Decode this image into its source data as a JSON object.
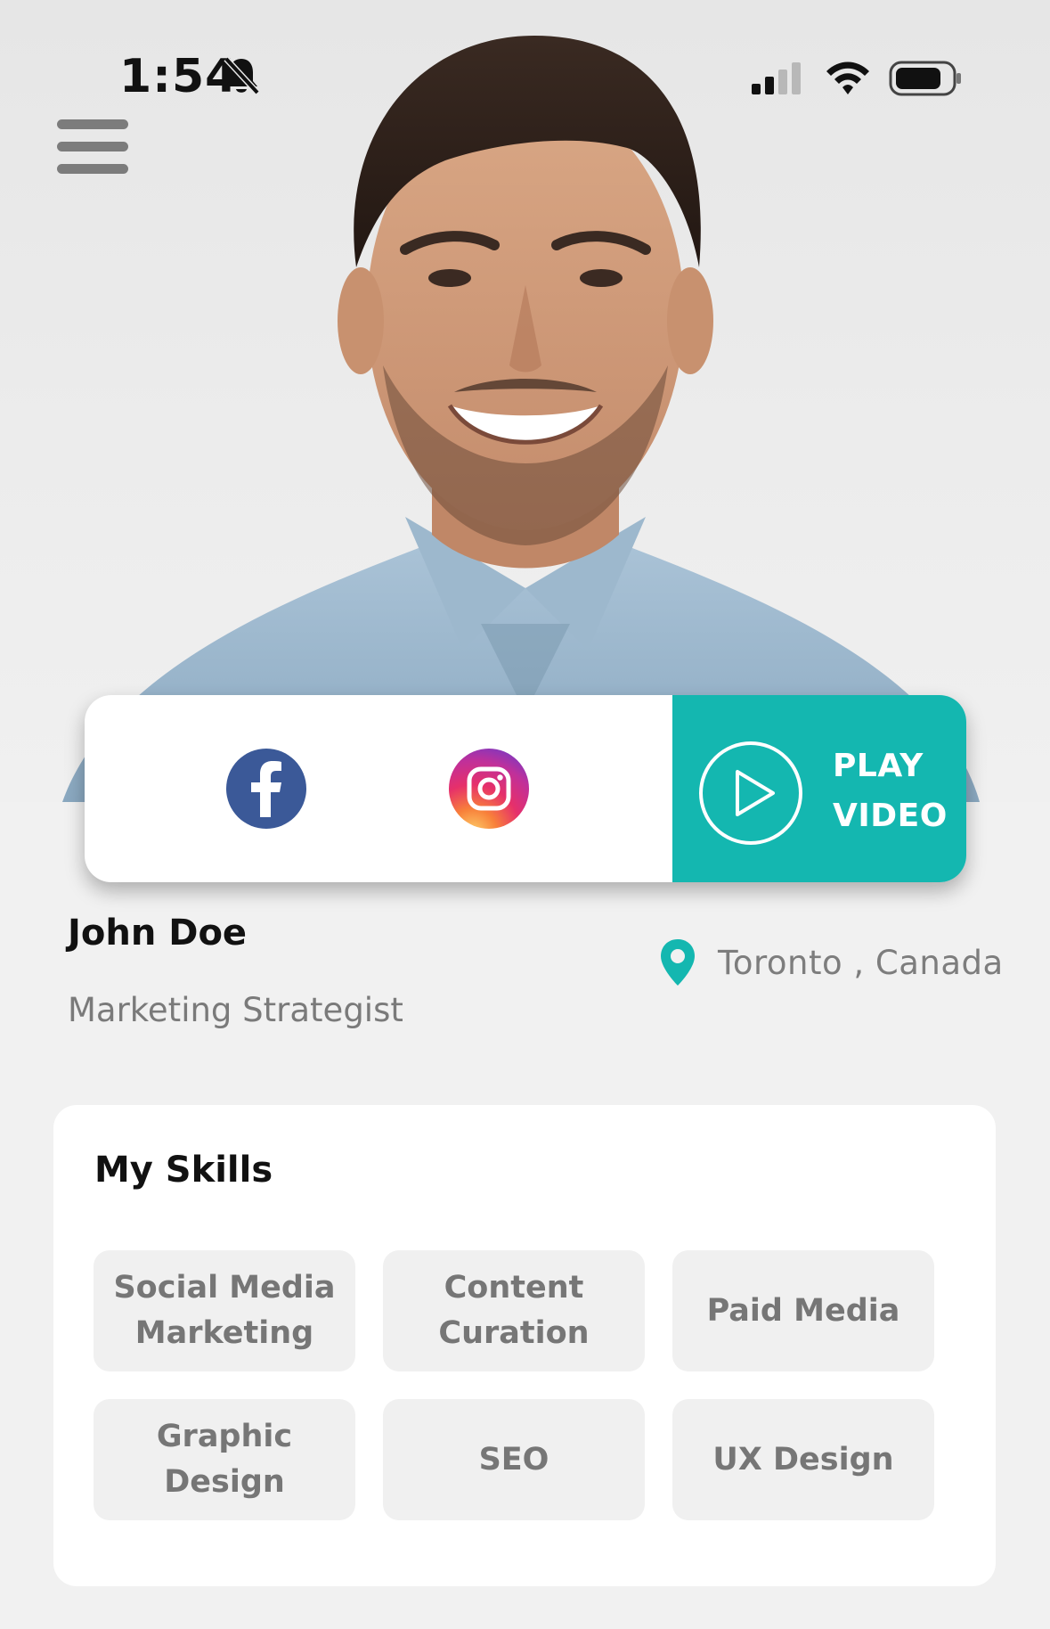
{
  "status_bar": {
    "time": "1:54",
    "bell_icon": "bell-slash-icon",
    "signal_icon": "cellular-signal-icon",
    "wifi_icon": "wifi-icon",
    "battery_icon": "battery-icon"
  },
  "header": {
    "menu_icon": "hamburger-menu-icon"
  },
  "actions": {
    "facebook_icon": "facebook-icon",
    "instagram_icon": "instagram-icon",
    "play_line1": "PLAY",
    "play_line2": "VIDEO",
    "play_icon": "play-circle-icon"
  },
  "profile": {
    "name": "John Doe",
    "title": "Marketing Strategist",
    "location": "Toronto , Canada",
    "location_icon": "map-pin-icon"
  },
  "skills": {
    "heading": "My Skills",
    "items": [
      "Social Media Marketing",
      "Content Curation",
      "Paid Media",
      "Graphic Design",
      "SEO",
      "UX Design"
    ]
  },
  "colors": {
    "accent": "#14b7b0",
    "facebook": "#3b5998",
    "text_dark": "#111111",
    "text_muted": "#7a7a7a",
    "chip_bg": "#f0f0f0"
  }
}
